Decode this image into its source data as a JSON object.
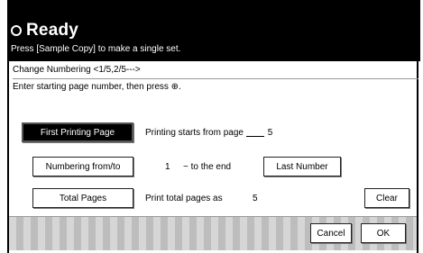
{
  "header": {
    "status": "Ready",
    "hint": "Press [Sample Copy] to make a single set."
  },
  "panel": {
    "title": "Change Numbering  <1/5,2/5--->",
    "instruction": "Enter starting page number, then press ⊕."
  },
  "rows": {
    "first_printing_page": {
      "button": "First Printing Page",
      "text": "Printing starts from page",
      "value": "5"
    },
    "numbering": {
      "button": "Numbering from/to",
      "start": "1",
      "range_text": "~ to the end",
      "last_number_button": "Last Number"
    },
    "total_pages": {
      "button": "Total Pages",
      "text": "Print total pages as",
      "value": "5"
    }
  },
  "actions": {
    "clear": "Clear",
    "cancel": "Cancel",
    "ok": "OK"
  }
}
